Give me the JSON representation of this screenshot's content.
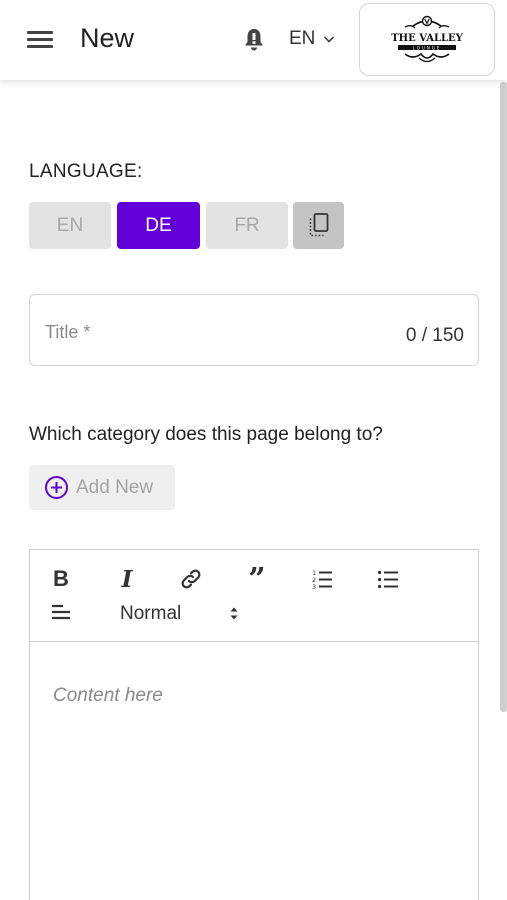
{
  "header": {
    "title": "New",
    "language_selector": "EN",
    "logo": {
      "line1": "THE VALLEY",
      "line2": "LOUNGE"
    },
    "icons": {
      "menu": "hamburger-icon",
      "notifications": "bell-icon",
      "dropdown": "chevron-down-icon"
    }
  },
  "language": {
    "label": "LANGUAGE:",
    "options": [
      "EN",
      "DE",
      "FR"
    ],
    "selected": "DE",
    "copy_icon": "copy-icon",
    "accent_color": "#6200d9"
  },
  "title_field": {
    "placeholder": "Title *",
    "counter": "0 / 150"
  },
  "category": {
    "question": "Which category does this page belong to?",
    "add_new_label": "Add New",
    "add_icon": "plus-circle-icon"
  },
  "editor": {
    "toolbar": {
      "bold": "B",
      "italic": "I",
      "quote": "”",
      "link_icon": "link-icon",
      "ordered_list_icon": "ordered-list-icon",
      "bullet_list_icon": "bullet-list-icon",
      "align_icon": "align-left-icon",
      "format_value": "Normal"
    },
    "content_placeholder": "Content here"
  }
}
